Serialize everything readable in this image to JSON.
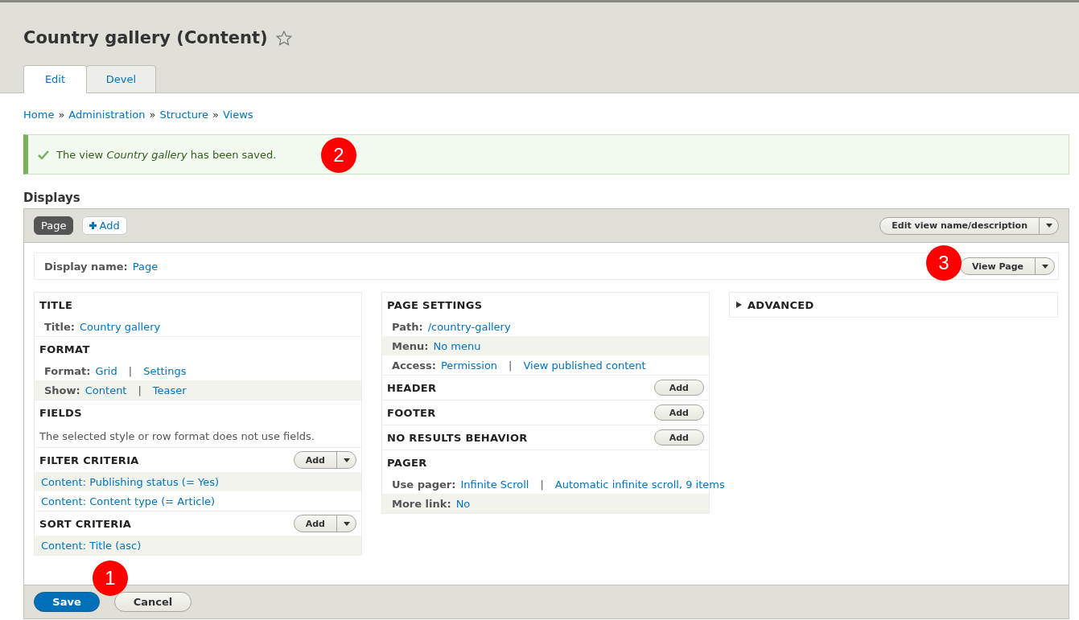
{
  "page_title": "Country gallery (Content)",
  "tabs": [
    {
      "label": "Edit",
      "selected": true
    },
    {
      "label": "Devel",
      "selected": false
    }
  ],
  "breadcrumb": [
    "Home",
    "Administration",
    "Structure",
    "Views"
  ],
  "breadcrumb_separator": "»",
  "message": {
    "text": "The view *Country gallery* has been saved.",
    "callout": "2"
  },
  "displays": {
    "heading": "Displays",
    "tabs": [
      {
        "label": "Page",
        "selected": true
      }
    ],
    "add_label": "Add",
    "edit_button": "Edit view name/description"
  },
  "display_name": {
    "label": "Display name:",
    "value": "Page",
    "view_button": "View Page",
    "callout": "3"
  },
  "link_separator": "|",
  "columns": [
    [
      {
        "title": "TITLE",
        "kind": "plain",
        "rows": [
          {
            "shaded": false,
            "label": "Title:",
            "links": [
              "Country gallery"
            ]
          }
        ]
      },
      {
        "title": "FORMAT",
        "kind": "plain",
        "rows": [
          {
            "shaded": false,
            "label": "Format:",
            "links": [
              "Grid",
              "Settings"
            ]
          },
          {
            "shaded": true,
            "label": "Show:",
            "links": [
              "Content",
              "Teaser"
            ]
          }
        ]
      },
      {
        "title": "FIELDS",
        "kind": "plain",
        "note": "The selected style or row format does not use fields."
      },
      {
        "title": "FILTER CRITERIA",
        "kind": "dropdown",
        "add_label": "Add",
        "rows": [
          {
            "shaded": true,
            "links": [
              "Content: Publishing status (= Yes)"
            ]
          },
          {
            "shaded": false,
            "links": [
              "Content: Content type (= Article)"
            ]
          }
        ]
      },
      {
        "title": "SORT CRITERIA",
        "kind": "dropdown",
        "add_label": "Add",
        "rows": [
          {
            "shaded": true,
            "links": [
              "Content: Title (asc)"
            ]
          }
        ]
      }
    ],
    [
      {
        "title": "PAGE SETTINGS",
        "kind": "plain",
        "rows": [
          {
            "shaded": false,
            "label": "Path:",
            "links": [
              "/country-gallery"
            ]
          },
          {
            "shaded": true,
            "label": "Menu:",
            "links": [
              "No menu"
            ]
          },
          {
            "shaded": false,
            "label": "Access:",
            "links": [
              "Permission",
              "View published content"
            ]
          }
        ]
      },
      {
        "title": "HEADER",
        "kind": "add",
        "add_label": "Add"
      },
      {
        "title": "FOOTER",
        "kind": "add",
        "add_label": "Add"
      },
      {
        "title": "NO RESULTS BEHAVIOR",
        "kind": "add",
        "add_label": "Add"
      },
      {
        "title": "PAGER",
        "kind": "plain",
        "rows": [
          {
            "shaded": false,
            "label": "Use pager:",
            "links": [
              "Infinite Scroll",
              "Automatic infinite scroll, 9 items"
            ]
          },
          {
            "shaded": true,
            "label": "More link:",
            "links": [
              "No"
            ]
          }
        ]
      }
    ]
  ],
  "advanced": {
    "label": "ADVANCED",
    "expanded": false
  },
  "actions": {
    "save": "Save",
    "cancel": "Cancel",
    "callout": "1"
  }
}
